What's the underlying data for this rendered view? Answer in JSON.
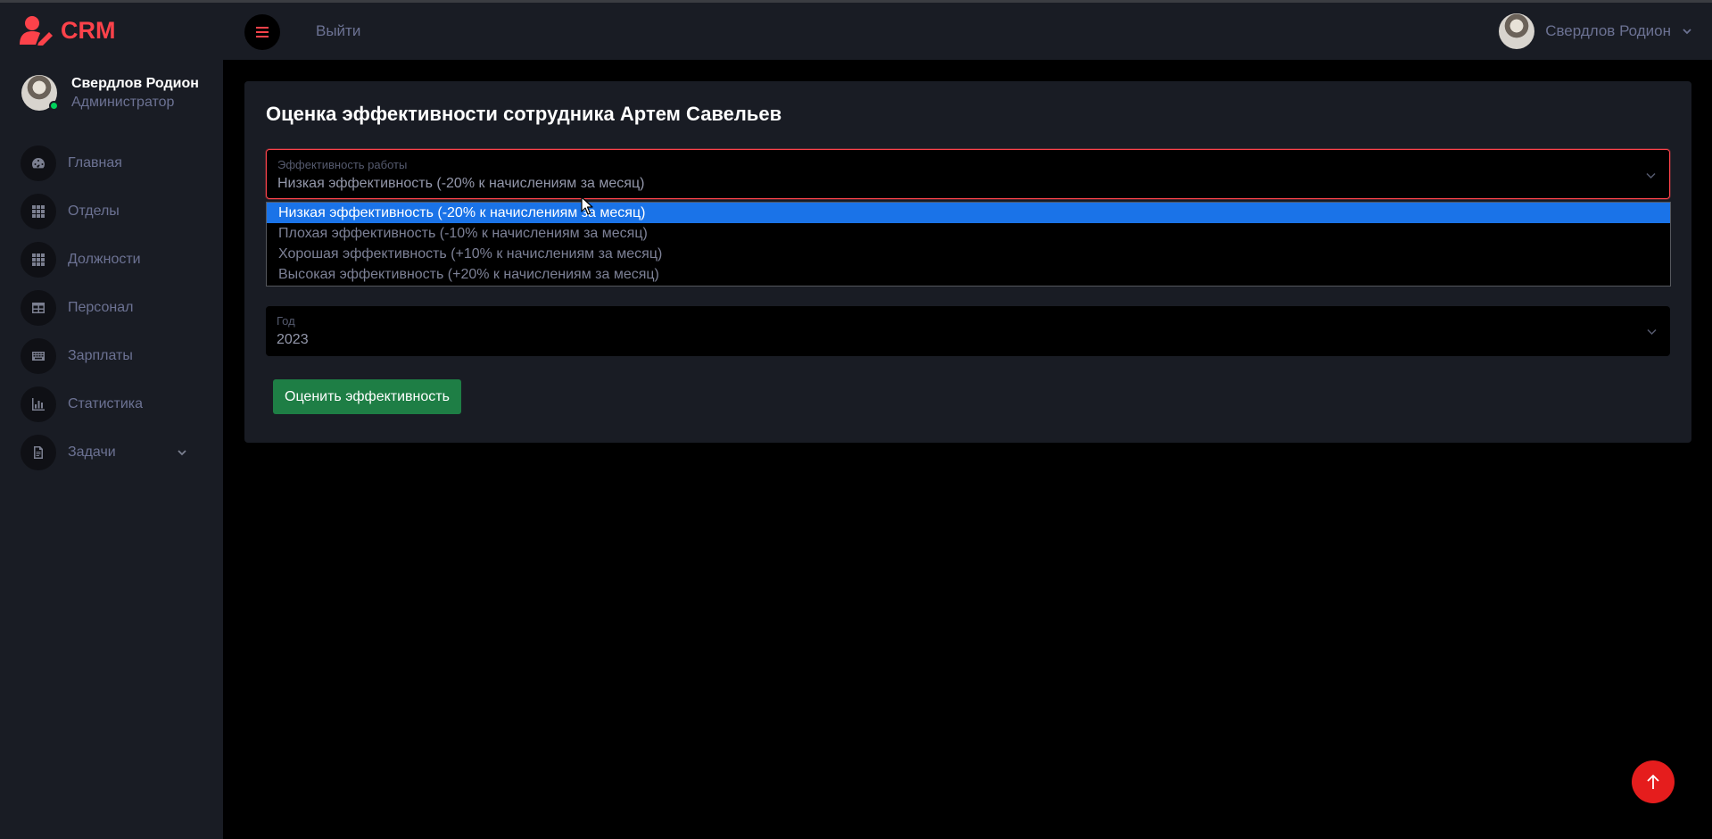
{
  "brand": {
    "name": "CRM"
  },
  "sidebar": {
    "profile": {
      "name": "Свердлов Родион",
      "role": "Администратор"
    },
    "items": [
      {
        "label": "Главная",
        "icon": "speedometer-icon"
      },
      {
        "label": "Отделы",
        "icon": "grid-icon"
      },
      {
        "label": "Должности",
        "icon": "grid-icon"
      },
      {
        "label": "Персонал",
        "icon": "table-icon"
      },
      {
        "label": "Зарплаты",
        "icon": "keyboard-icon"
      },
      {
        "label": "Статистика",
        "icon": "chart-icon"
      },
      {
        "label": "Задачи",
        "icon": "document-icon"
      }
    ]
  },
  "navbar": {
    "logout_label": "Выйти",
    "user_name": "Свердлов Родион"
  },
  "card": {
    "title": "Оценка эффективности сотрудника Артем Савельев",
    "efficiency_select": {
      "label": "Эффективность работы",
      "value": "Низкая эффективность (-20% к начислениям за месяц)",
      "options": [
        "Низкая эффективность (-20% к начислениям за месяц)",
        "Плохая эффективность (-10% к начислениям за месяц)",
        "Хорошая эффективность (+10% к начислениям за месяц)",
        "Высокая эффективность (+20% к начислениям за месяц)"
      ]
    },
    "year_select": {
      "label": "Год",
      "value": "2023"
    },
    "submit_label": "Оценить эффективность"
  },
  "colors": {
    "accent": "#fc424a",
    "success": "#1e7e45",
    "highlight": "#1a73e8",
    "sidebar_bg": "#191c24"
  }
}
